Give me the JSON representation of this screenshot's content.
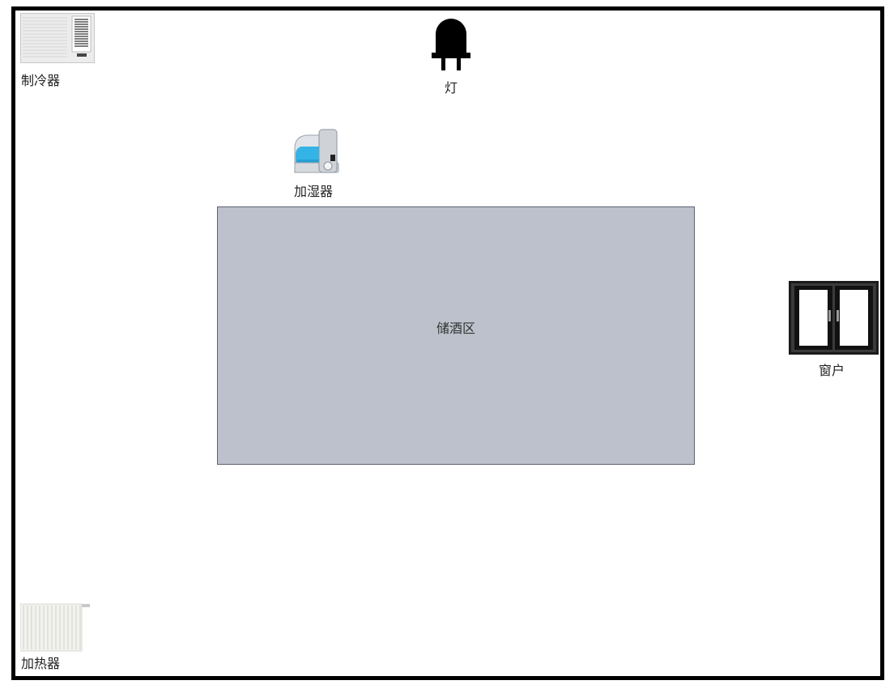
{
  "room": {
    "devices": {
      "cooler": {
        "label": "制冷器",
        "icon": "air-conditioner-icon"
      },
      "light": {
        "label": "灯",
        "icon": "bulb-icon"
      },
      "humidifier": {
        "label": "加湿器",
        "icon": "humidifier-icon"
      },
      "window": {
        "label": "窗户",
        "icon": "window-icon"
      },
      "heater": {
        "label": "加热器",
        "icon": "radiator-icon"
      }
    },
    "zone": {
      "label": "储酒区",
      "color": "#bcc1cb"
    },
    "wall_color": "#000000"
  }
}
